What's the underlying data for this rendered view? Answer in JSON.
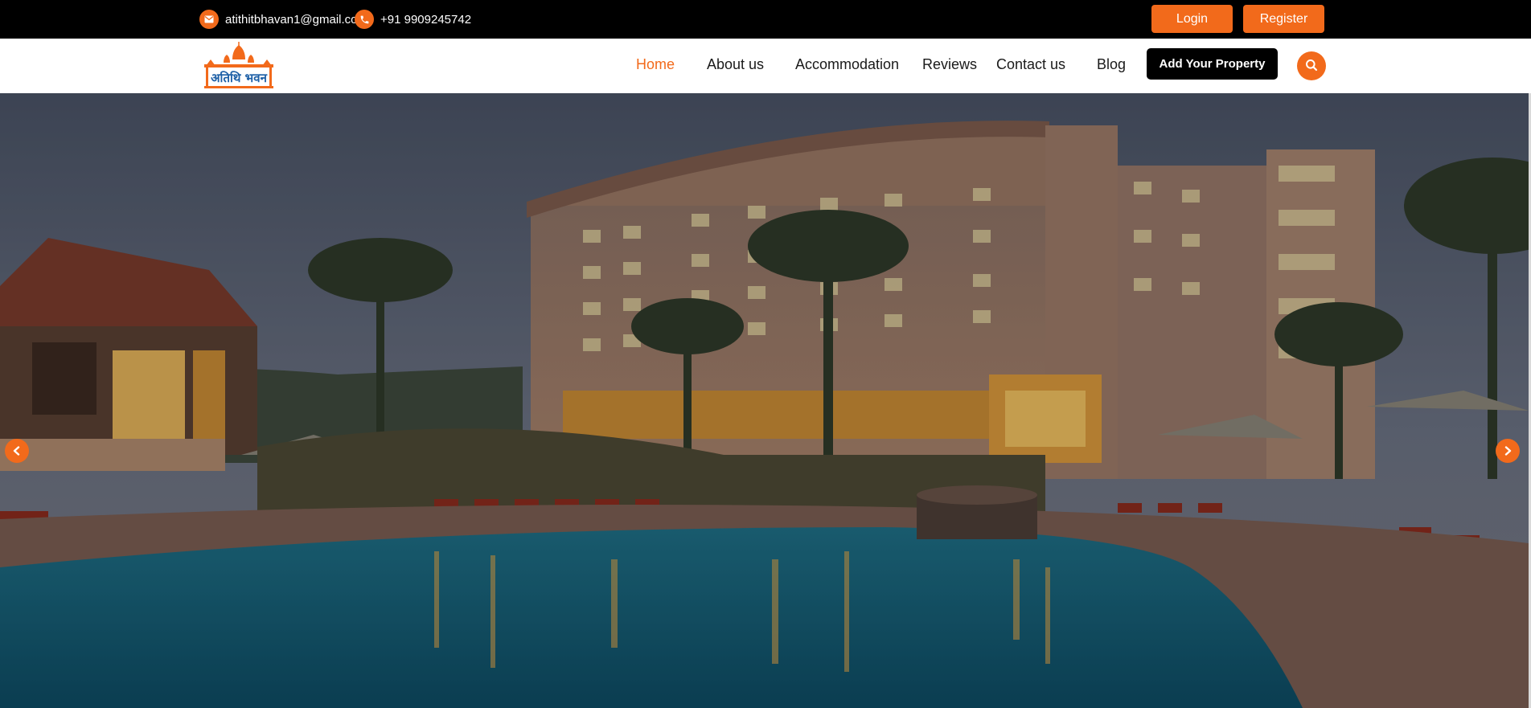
{
  "topbar": {
    "email": "atithitbhavan1@gmail.com",
    "phone": "+91 9909245742",
    "login_label": "Login",
    "register_label": "Register"
  },
  "brand": {
    "logo_text": "अतिथि भवन"
  },
  "nav": {
    "items": [
      {
        "label": "Home",
        "active": true
      },
      {
        "label": "About us",
        "active": false
      },
      {
        "label": "Accommodation",
        "active": false
      },
      {
        "label": "Reviews",
        "active": false
      },
      {
        "label": "Contact us",
        "active": false
      },
      {
        "label": "Blog",
        "active": false
      }
    ],
    "add_property_label": "Add Your Property"
  },
  "icons": {
    "email": "envelope-icon",
    "phone": "phone-icon",
    "search": "search-icon",
    "prev": "chevron-left-icon",
    "next": "chevron-right-icon"
  },
  "colors": {
    "accent": "#f26a1b",
    "topbar": "#000000",
    "nav_text": "#1a1a1a"
  }
}
